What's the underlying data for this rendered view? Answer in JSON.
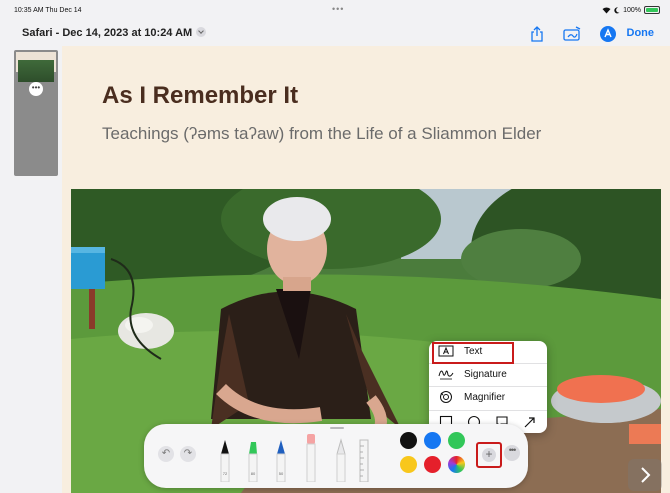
{
  "status_bar": {
    "time_date": "10:35 AM  Thu Dec 14",
    "battery": "100%",
    "battery_level": 1.0
  },
  "toolbar": {
    "title": "Safari - Dec 14, 2023 at 10:24 AM",
    "done_label": "Done",
    "icons": [
      "share-icon",
      "edit-markup-icon",
      "markup-pen-icon"
    ]
  },
  "sidebar": {
    "thumbnails": [
      {
        "page": 1,
        "selected": true
      }
    ]
  },
  "page": {
    "title": "As I Remember It",
    "subtitle": "Teachings (ʔəms taʔaw) from the Life of a Sliammon Elder"
  },
  "palette": {
    "tools": [
      "pen",
      "marker",
      "pencil",
      "eraser",
      "lasso",
      "ruler"
    ],
    "pen_sizes": [
      "72",
      "80",
      "50"
    ],
    "colors": [
      "#111111",
      "#1677f2",
      "#32c759",
      "#f8c71c",
      "#e5202b",
      "multicolor"
    ],
    "plus_icon": "plus-icon",
    "more_icon": "more-icon"
  },
  "popup_menu": {
    "items": [
      {
        "label": "Text",
        "icon": "text-box-icon"
      },
      {
        "label": "Signature",
        "icon": "signature-icon"
      },
      {
        "label": "Magnifier",
        "icon": "magnifier-icon"
      }
    ],
    "shapes": [
      "square-shape-icon",
      "circle-shape-icon",
      "speech-bubble-icon",
      "arrow-icon"
    ]
  },
  "colors": {
    "accent": "#1677f2",
    "highlight": "#c91b1b",
    "page_background": "#f8eedf",
    "title": "#4a2d1f"
  }
}
